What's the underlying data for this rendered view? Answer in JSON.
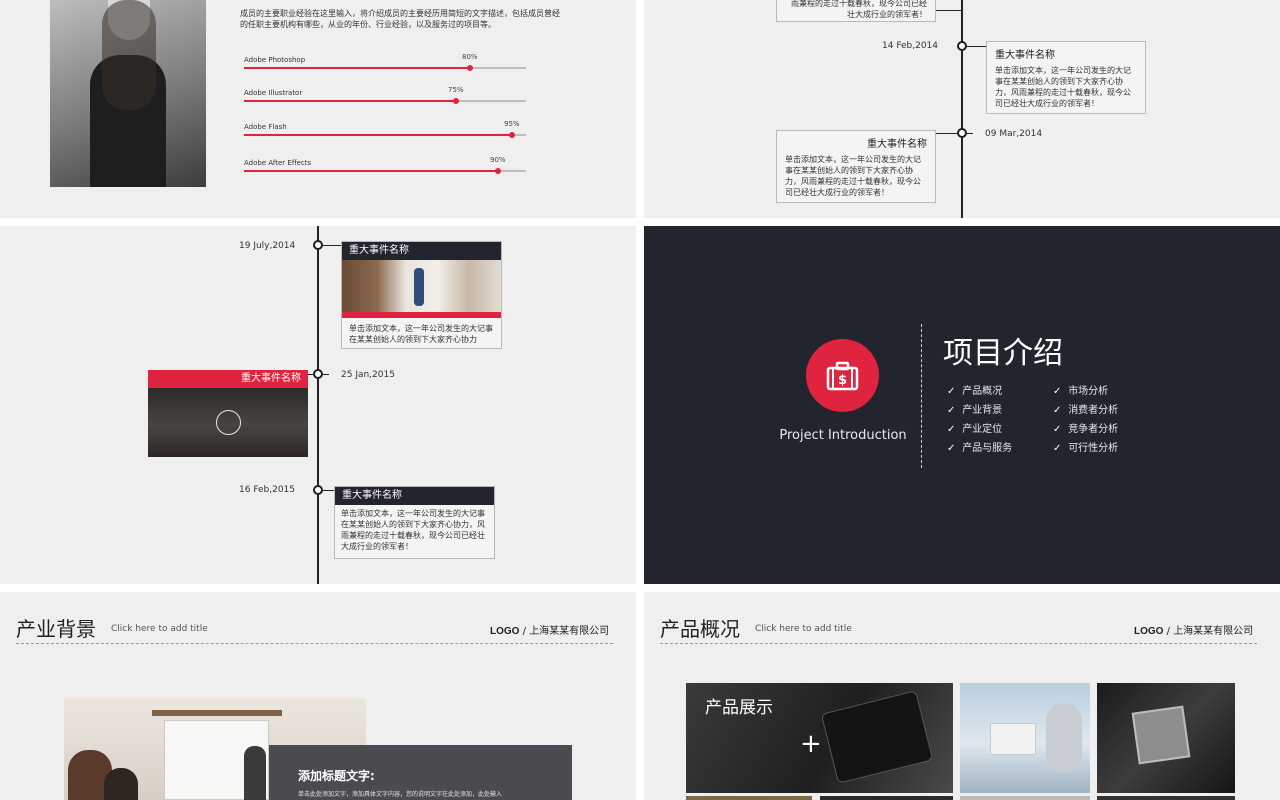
{
  "profile": {
    "desc": "成员的主要职业经验在这里输入，将介绍成员的主要经历用简短的文字描述，包括成员曾经的任职主要机构有哪些，从业的年份、行业经验，以及服务过的项目等。",
    "skills": [
      {
        "label": "Adobe Photoshop",
        "percent": 80,
        "percent_label": "80%"
      },
      {
        "label": "Adobe Illustrator",
        "percent": 75,
        "percent_label": "75%"
      },
      {
        "label": "Adobe Flash",
        "percent": 95,
        "percent_label": "95%"
      },
      {
        "label": "Adobe After Effects",
        "percent": 90,
        "percent_label": "90%"
      }
    ]
  },
  "timeline1": {
    "top_fragment": "雨兼程的走过十载春秋，现今公司已经壮大成行业的领军者！",
    "events": [
      {
        "date": "14 Feb,2014",
        "title": "重大事件名称",
        "text": "单击添加文本，这一年公司发生的大记事在某某创始人的领到下大家齐心协力，风雨兼程的走过十载春秋，现今公司已经壮大成行业的领军者！"
      },
      {
        "date": "09 Mar,2014",
        "title": "重大事件名称",
        "text": "单击添加文本，这一年公司发生的大记事在某某创始人的领到下大家齐心协力，风雨兼程的走过十载春秋，现今公司已经壮大成行业的领军者！"
      }
    ]
  },
  "timeline2": {
    "events": [
      {
        "date": "19 July,2014",
        "title": "重大事件名称",
        "text": "单击添加文本，这一年公司发生的大记事在某某创始人的领到下大家齐心协力"
      },
      {
        "date": "25 Jan,2015",
        "title": "重大事件名称"
      },
      {
        "date": "16 Feb,2015",
        "title": "重大事件名称",
        "text": "单击添加文本，这一年公司发生的大记事在某某创始人的领到下大家齐心协力，风雨兼程的走过十载春秋，现今公司已经壮大成行业的领军者！"
      }
    ]
  },
  "project": {
    "title": "项目介绍",
    "subtitle": "Project Introduction",
    "icon": "briefcase-dollar-icon",
    "col1": [
      "产品概况",
      "产业背景",
      "产业定位",
      "产品与服务"
    ],
    "col2": [
      "市场分析",
      "消费者分析",
      "竞争者分析",
      "可行性分析"
    ]
  },
  "industry": {
    "title": "产业背景",
    "subtitle": "Click here to add title",
    "logo": "LOGO",
    "company": "上海某某有限公司",
    "card_title": "添加标题文字:",
    "card_text": "单击此处添加文字，添加具体文字内容，您的说明文字在此处添加，此处输入"
  },
  "product": {
    "title": "产品概况",
    "subtitle": "Click here to add title",
    "logo": "LOGO",
    "company": "上海某某有限公司",
    "showcase": "产品展示"
  },
  "colors": {
    "accent": "#e0243f",
    "dark": "#22252e",
    "panel": "#efefef"
  }
}
